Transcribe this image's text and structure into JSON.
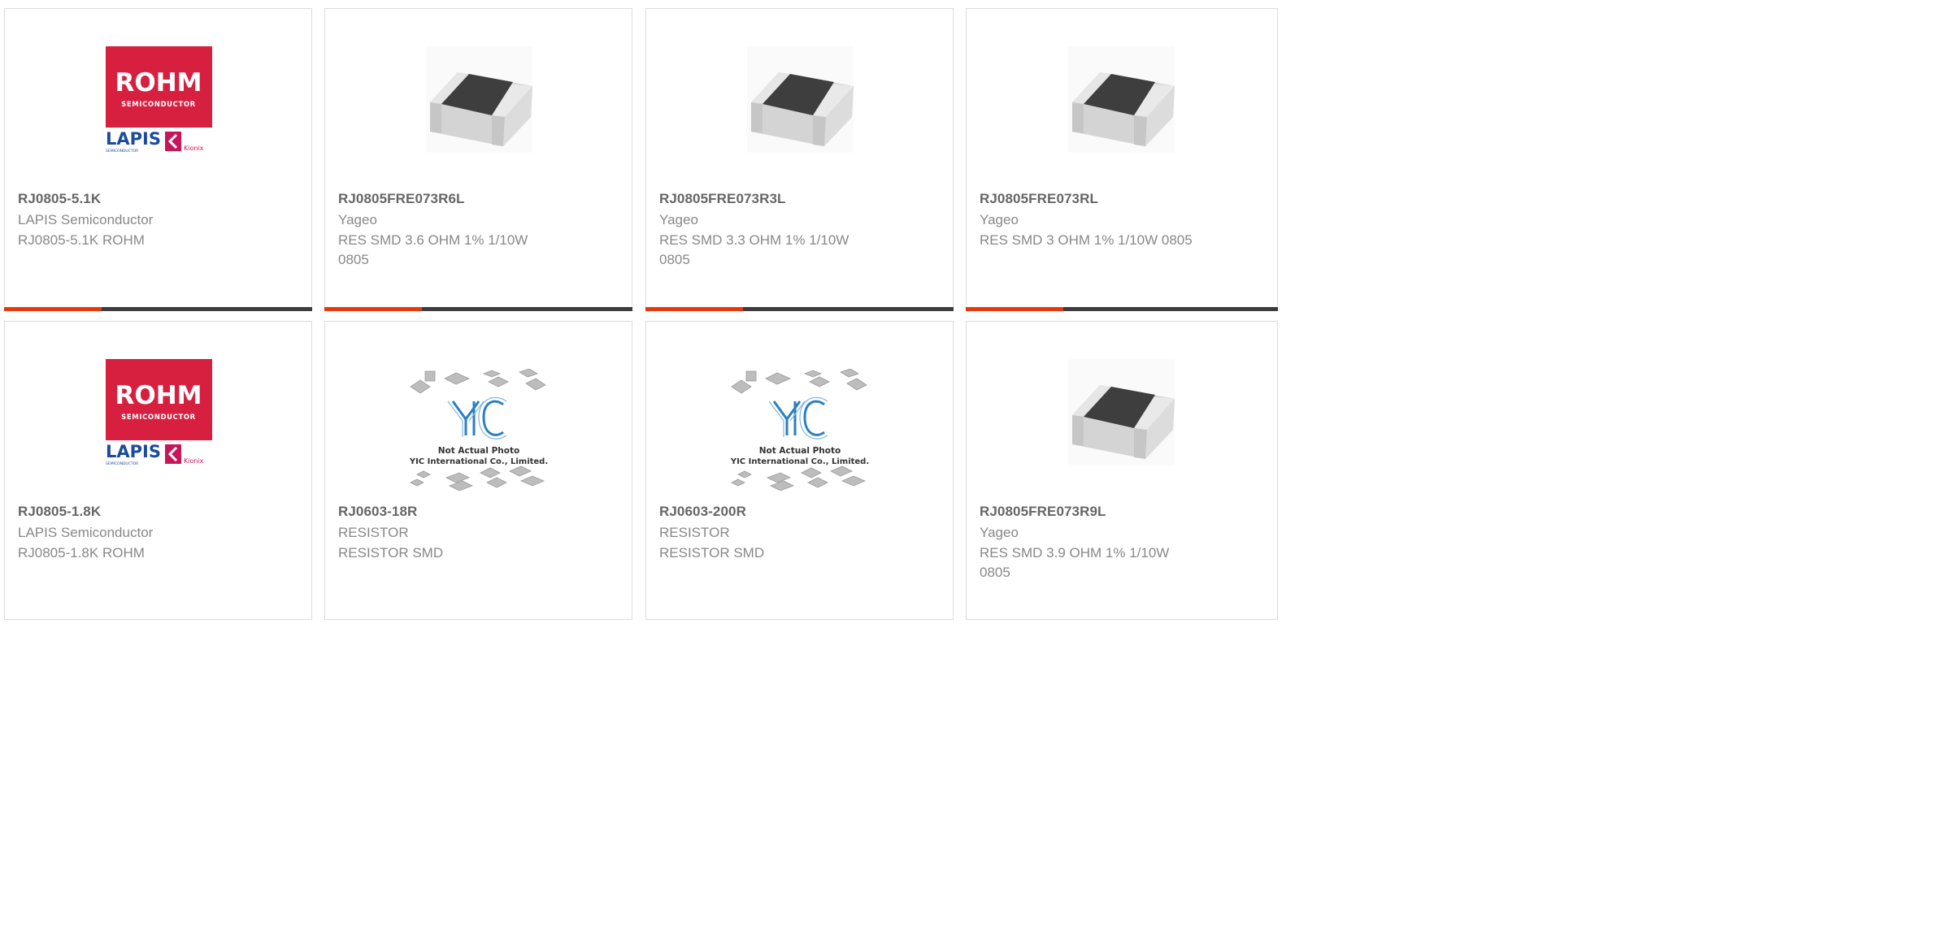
{
  "colors": {
    "accent": "#e8380d",
    "bar": "#3c3c3c",
    "rohm_red": "#d71f3f",
    "lapis_blue": "#1c4a9c",
    "yic_blue": "#2a7fc1"
  },
  "image_text": {
    "rohm": "ROHM",
    "semiconductor": "SEMICONDUCTOR",
    "lapis": "LAPIS",
    "lapis_sub": "SEMICONDUCTOR",
    "kionix": "Kionix",
    "yic": "YIC",
    "not_actual": "Not Actual Photo",
    "yic_company": "YIC International Co., Limited."
  },
  "products": [
    {
      "part_number": "RJ0805-5.1K",
      "manufacturer": "LAPIS Semiconductor",
      "description": "RJ0805-5.1K ROHM",
      "image": "rohm-lapis-logo",
      "has_accent_bar": true
    },
    {
      "part_number": "RJ0805FRE073R6L",
      "manufacturer": "Yageo",
      "description": "RES SMD 3.6 OHM 1% 1/10W 0805",
      "image": "smd-resistor-chip",
      "has_accent_bar": true
    },
    {
      "part_number": "RJ0805FRE073R3L",
      "manufacturer": "Yageo",
      "description": "RES SMD 3.3 OHM 1% 1/10W 0805",
      "image": "smd-resistor-chip",
      "has_accent_bar": true
    },
    {
      "part_number": "RJ0805FRE073RL",
      "manufacturer": "Yageo",
      "description": "RES SMD 3 OHM 1% 1/10W 0805",
      "image": "smd-resistor-chip",
      "has_accent_bar": true
    },
    {
      "part_number": "RJ0805-1.8K",
      "manufacturer": "LAPIS Semiconductor",
      "description": "RJ0805-1.8K ROHM",
      "image": "rohm-lapis-logo",
      "has_accent_bar": false
    },
    {
      "part_number": "RJ0603-18R",
      "manufacturer": "RESISTOR",
      "description": "RESISTOR SMD",
      "image": "yic-not-actual-photo",
      "has_accent_bar": false
    },
    {
      "part_number": "RJ0603-200R",
      "manufacturer": "RESISTOR",
      "description": "RESISTOR SMD",
      "image": "yic-not-actual-photo",
      "has_accent_bar": false
    },
    {
      "part_number": "RJ0805FRE073R9L",
      "manufacturer": "Yageo",
      "description": "RES SMD 3.9 OHM 1% 1/10W 0805",
      "image": "smd-resistor-chip",
      "has_accent_bar": false
    }
  ]
}
